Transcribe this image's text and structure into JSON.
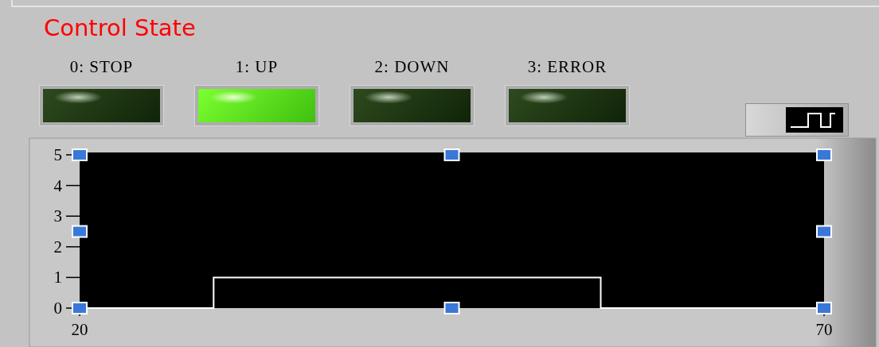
{
  "title": "Control State",
  "indicators": [
    {
      "label": "0: STOP",
      "on": false
    },
    {
      "label": "1: UP",
      "on": true
    },
    {
      "label": "2: DOWN",
      "on": false
    },
    {
      "label": "3: ERROR",
      "on": false
    }
  ],
  "chart": {
    "chart_data": {
      "type": "line",
      "x": [
        20,
        29,
        29,
        55,
        55,
        70
      ],
      "series": [
        {
          "color": "#ffffff",
          "values": [
            0,
            0,
            1,
            1,
            0,
            0
          ]
        }
      ],
      "xlim": [
        20,
        70
      ],
      "ylim": [
        0,
        5
      ],
      "xticks": [
        20,
        70
      ],
      "yticks": [
        0,
        1,
        2,
        3,
        4,
        5
      ]
    }
  }
}
